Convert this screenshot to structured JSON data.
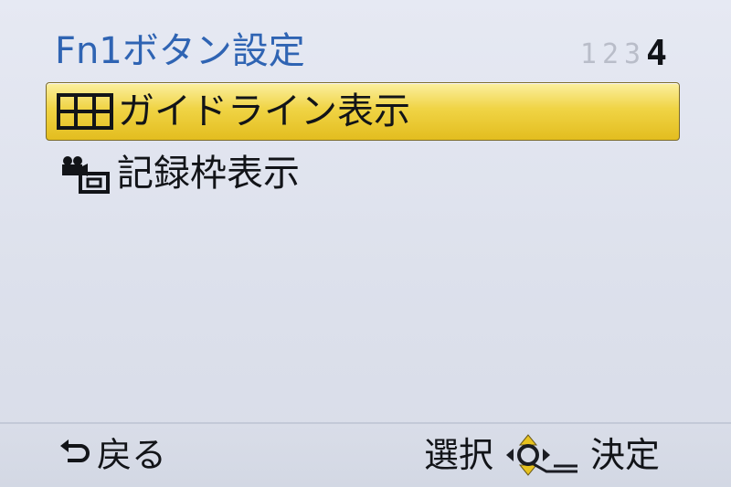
{
  "header": {
    "title": "Fn1ボタン設定",
    "pages": [
      {
        "label": "1",
        "active": false
      },
      {
        "label": "2",
        "active": false
      },
      {
        "label": "3",
        "active": false
      },
      {
        "label": "4",
        "active": true
      }
    ]
  },
  "menu": {
    "items": [
      {
        "label": "ガイドライン表示",
        "icon": "grid-icon",
        "selected": true
      },
      {
        "label": "記録枠表示",
        "icon": "movie-frame-icon",
        "selected": false
      }
    ]
  },
  "footer": {
    "back_label": "戻る",
    "select_label": "選択",
    "confirm_label": "決定",
    "back_icon": "return-arrow-icon",
    "dial_icon": "cursor-dial-icon"
  },
  "colors": {
    "title": "#2f64b3",
    "selected_top": "#fbf0a0",
    "selected_bottom": "#e3bd1f",
    "background": "#e2e6f0",
    "page_inactive": "#b9bdc9",
    "page_active": "#111318"
  }
}
